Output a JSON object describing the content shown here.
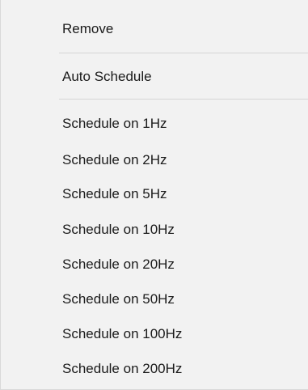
{
  "context_menu": {
    "items": [
      {
        "label": "Remove"
      },
      {
        "label": "Auto Schedule"
      },
      {
        "label": "Schedule on 1Hz"
      },
      {
        "label": "Schedule on 2Hz"
      },
      {
        "label": "Schedule on 5Hz"
      },
      {
        "label": "Schedule on 10Hz"
      },
      {
        "label": "Schedule on 20Hz"
      },
      {
        "label": "Schedule on 50Hz"
      },
      {
        "label": "Schedule on 100Hz"
      },
      {
        "label": "Schedule on 200Hz"
      }
    ]
  }
}
